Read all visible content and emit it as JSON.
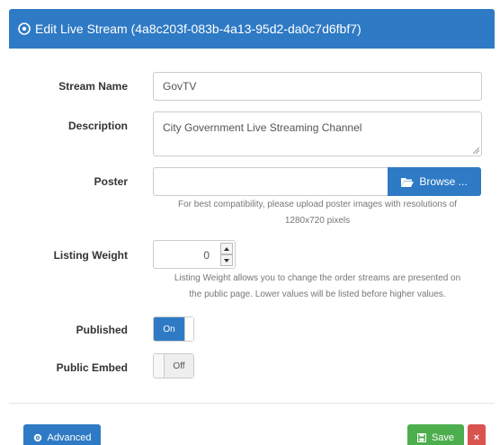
{
  "dialog": {
    "title": "Edit Live Stream (4a8c203f-083b-4a13-95d2-da0c7d6fbf7)"
  },
  "form": {
    "stream_name": {
      "label": "Stream Name",
      "value": "GovTV"
    },
    "description": {
      "label": "Description",
      "value": "City Government Live Streaming Channel"
    },
    "poster": {
      "label": "Poster",
      "value": "",
      "browse_label": "Browse ...",
      "help_line1": "For best compatibility, please upload poster images with resolutions of",
      "help_line2": "1280x720 pixels"
    },
    "listing_weight": {
      "label": "Listing Weight",
      "value": "0",
      "help_line1": "Listing Weight allows you to change the order streams are presented on",
      "help_line2": "the public page. Lower values will be listed before higher values."
    },
    "published": {
      "label": "Published",
      "state": "On"
    },
    "public_embed": {
      "label": "Public Embed",
      "state": "Off"
    }
  },
  "footer": {
    "advanced_label": "Advanced",
    "save_label": "Save",
    "delete_label": "×"
  },
  "colors": {
    "primary": "#2f7ac4",
    "success": "#4cae4c",
    "danger": "#d9534f"
  }
}
